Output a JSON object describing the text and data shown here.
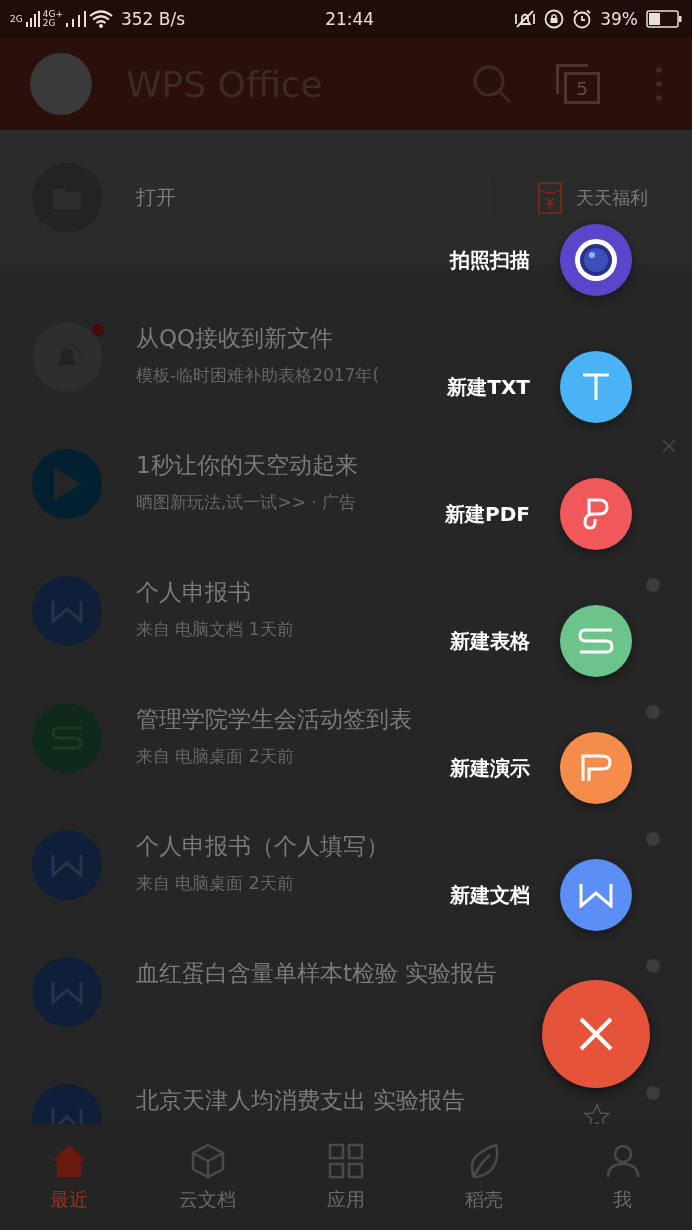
{
  "status_bar": {
    "sim1": "2G",
    "sim2_top": "4G+",
    "sim2_bottom": "2G",
    "speed": "352 B/s",
    "time": "21:44",
    "battery": "39%"
  },
  "header": {
    "title": "WPS Office",
    "tab_count": "5"
  },
  "open_bar": {
    "label": "打开",
    "promo": "天天福利"
  },
  "files": [
    {
      "kind": "notice",
      "title": "从QQ接收到新文件",
      "subtitle": "模板-临时困难补助表格2017年(",
      "unread": true
    },
    {
      "kind": "ad",
      "title": "1秒让你的天空动起来",
      "subtitle": "晒图新玩法,试一试>> · 广告"
    },
    {
      "kind": "writer",
      "title": "个人申报书",
      "subtitle": "来自 电脑文档  1天前"
    },
    {
      "kind": "sheet",
      "title": "管理学院学生会活动签到表",
      "subtitle": "来自 电脑桌面  2天前"
    },
    {
      "kind": "writer",
      "title": "个人申报书（个人填写）",
      "subtitle": "来自 电脑桌面  2天前"
    },
    {
      "kind": "writer",
      "title": "血红蛋白含量单样本t检验 实验报告"
    },
    {
      "kind": "writer",
      "title": "北京天津人均消费支出 实验报告",
      "starred": false
    }
  ],
  "fab_menu": [
    {
      "kind": "scan",
      "label": "拍照扫描"
    },
    {
      "kind": "txt",
      "label": "新建TXT"
    },
    {
      "kind": "pdf",
      "label": "新建PDF"
    },
    {
      "kind": "sheet",
      "label": "新建表格"
    },
    {
      "kind": "slides",
      "label": "新建演示"
    },
    {
      "kind": "doc",
      "label": "新建文档"
    }
  ],
  "bottom_nav": [
    {
      "kind": "home",
      "label": "最近",
      "selected": true
    },
    {
      "kind": "cloud",
      "label": "云文档",
      "selected": false
    },
    {
      "kind": "apps",
      "label": "应用",
      "selected": false
    },
    {
      "kind": "leaf",
      "label": "稻壳",
      "selected": false
    },
    {
      "kind": "me",
      "label": "我",
      "selected": false
    }
  ]
}
